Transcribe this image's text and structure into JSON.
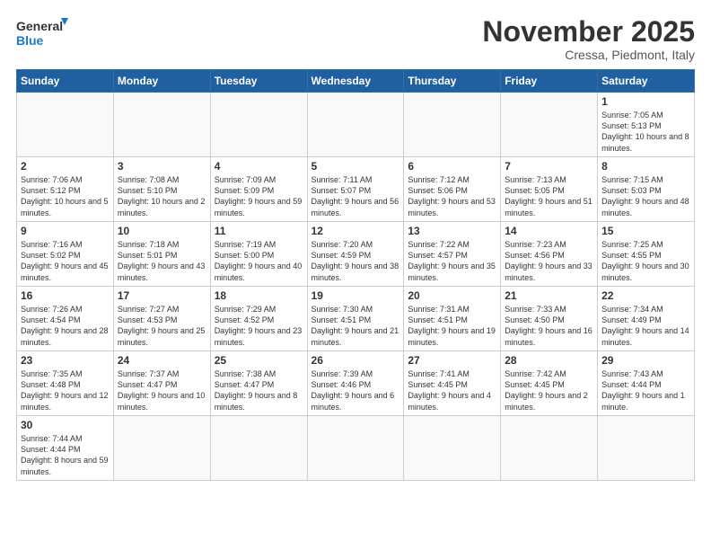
{
  "logo": {
    "text_general": "General",
    "text_blue": "Blue"
  },
  "header": {
    "month": "November 2025",
    "location": "Cressa, Piedmont, Italy"
  },
  "weekdays": [
    "Sunday",
    "Monday",
    "Tuesday",
    "Wednesday",
    "Thursday",
    "Friday",
    "Saturday"
  ],
  "weeks": [
    [
      {
        "day": "",
        "info": ""
      },
      {
        "day": "",
        "info": ""
      },
      {
        "day": "",
        "info": ""
      },
      {
        "day": "",
        "info": ""
      },
      {
        "day": "",
        "info": ""
      },
      {
        "day": "",
        "info": ""
      },
      {
        "day": "1",
        "info": "Sunrise: 7:05 AM\nSunset: 5:13 PM\nDaylight: 10 hours and 8 minutes."
      }
    ],
    [
      {
        "day": "2",
        "info": "Sunrise: 7:06 AM\nSunset: 5:12 PM\nDaylight: 10 hours and 5 minutes."
      },
      {
        "day": "3",
        "info": "Sunrise: 7:08 AM\nSunset: 5:10 PM\nDaylight: 10 hours and 2 minutes."
      },
      {
        "day": "4",
        "info": "Sunrise: 7:09 AM\nSunset: 5:09 PM\nDaylight: 9 hours and 59 minutes."
      },
      {
        "day": "5",
        "info": "Sunrise: 7:11 AM\nSunset: 5:07 PM\nDaylight: 9 hours and 56 minutes."
      },
      {
        "day": "6",
        "info": "Sunrise: 7:12 AM\nSunset: 5:06 PM\nDaylight: 9 hours and 53 minutes."
      },
      {
        "day": "7",
        "info": "Sunrise: 7:13 AM\nSunset: 5:05 PM\nDaylight: 9 hours and 51 minutes."
      },
      {
        "day": "8",
        "info": "Sunrise: 7:15 AM\nSunset: 5:03 PM\nDaylight: 9 hours and 48 minutes."
      }
    ],
    [
      {
        "day": "9",
        "info": "Sunrise: 7:16 AM\nSunset: 5:02 PM\nDaylight: 9 hours and 45 minutes."
      },
      {
        "day": "10",
        "info": "Sunrise: 7:18 AM\nSunset: 5:01 PM\nDaylight: 9 hours and 43 minutes."
      },
      {
        "day": "11",
        "info": "Sunrise: 7:19 AM\nSunset: 5:00 PM\nDaylight: 9 hours and 40 minutes."
      },
      {
        "day": "12",
        "info": "Sunrise: 7:20 AM\nSunset: 4:59 PM\nDaylight: 9 hours and 38 minutes."
      },
      {
        "day": "13",
        "info": "Sunrise: 7:22 AM\nSunset: 4:57 PM\nDaylight: 9 hours and 35 minutes."
      },
      {
        "day": "14",
        "info": "Sunrise: 7:23 AM\nSunset: 4:56 PM\nDaylight: 9 hours and 33 minutes."
      },
      {
        "day": "15",
        "info": "Sunrise: 7:25 AM\nSunset: 4:55 PM\nDaylight: 9 hours and 30 minutes."
      }
    ],
    [
      {
        "day": "16",
        "info": "Sunrise: 7:26 AM\nSunset: 4:54 PM\nDaylight: 9 hours and 28 minutes."
      },
      {
        "day": "17",
        "info": "Sunrise: 7:27 AM\nSunset: 4:53 PM\nDaylight: 9 hours and 25 minutes."
      },
      {
        "day": "18",
        "info": "Sunrise: 7:29 AM\nSunset: 4:52 PM\nDaylight: 9 hours and 23 minutes."
      },
      {
        "day": "19",
        "info": "Sunrise: 7:30 AM\nSunset: 4:51 PM\nDaylight: 9 hours and 21 minutes."
      },
      {
        "day": "20",
        "info": "Sunrise: 7:31 AM\nSunset: 4:51 PM\nDaylight: 9 hours and 19 minutes."
      },
      {
        "day": "21",
        "info": "Sunrise: 7:33 AM\nSunset: 4:50 PM\nDaylight: 9 hours and 16 minutes."
      },
      {
        "day": "22",
        "info": "Sunrise: 7:34 AM\nSunset: 4:49 PM\nDaylight: 9 hours and 14 minutes."
      }
    ],
    [
      {
        "day": "23",
        "info": "Sunrise: 7:35 AM\nSunset: 4:48 PM\nDaylight: 9 hours and 12 minutes."
      },
      {
        "day": "24",
        "info": "Sunrise: 7:37 AM\nSunset: 4:47 PM\nDaylight: 9 hours and 10 minutes."
      },
      {
        "day": "25",
        "info": "Sunrise: 7:38 AM\nSunset: 4:47 PM\nDaylight: 9 hours and 8 minutes."
      },
      {
        "day": "26",
        "info": "Sunrise: 7:39 AM\nSunset: 4:46 PM\nDaylight: 9 hours and 6 minutes."
      },
      {
        "day": "27",
        "info": "Sunrise: 7:41 AM\nSunset: 4:45 PM\nDaylight: 9 hours and 4 minutes."
      },
      {
        "day": "28",
        "info": "Sunrise: 7:42 AM\nSunset: 4:45 PM\nDaylight: 9 hours and 2 minutes."
      },
      {
        "day": "29",
        "info": "Sunrise: 7:43 AM\nSunset: 4:44 PM\nDaylight: 9 hours and 1 minute."
      }
    ],
    [
      {
        "day": "30",
        "info": "Sunrise: 7:44 AM\nSunset: 4:44 PM\nDaylight: 8 hours and 59 minutes."
      },
      {
        "day": "",
        "info": ""
      },
      {
        "day": "",
        "info": ""
      },
      {
        "day": "",
        "info": ""
      },
      {
        "day": "",
        "info": ""
      },
      {
        "day": "",
        "info": ""
      },
      {
        "day": "",
        "info": ""
      }
    ]
  ]
}
